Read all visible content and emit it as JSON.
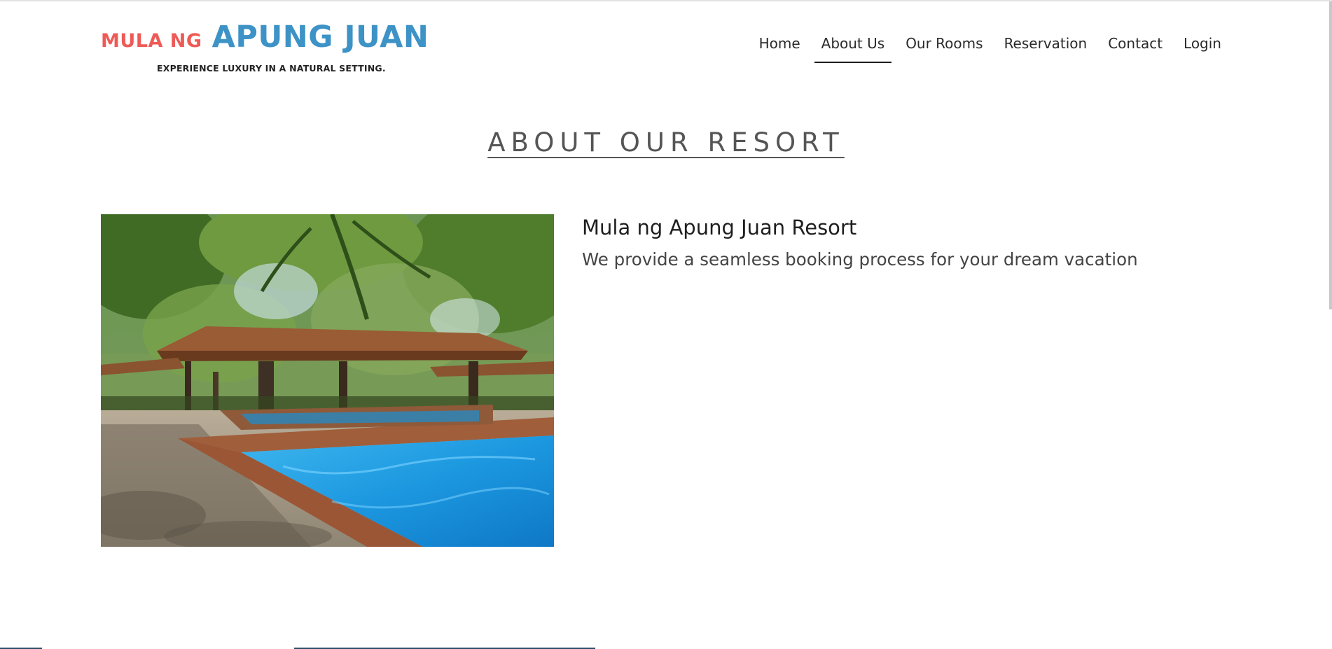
{
  "brand": {
    "prefix": "MULA NG",
    "name": "APUNG JUAN",
    "tagline": "EXPERIENCE LUXURY IN A NATURAL SETTING.",
    "colors": {
      "prefix": "#ee5b57",
      "name": "#3d92c6"
    }
  },
  "nav": {
    "items": [
      {
        "label": "Home"
      },
      {
        "label": "About Us",
        "active": true
      },
      {
        "label": "Our Rooms"
      },
      {
        "label": "Reservation"
      },
      {
        "label": "Contact"
      },
      {
        "label": "Login"
      }
    ]
  },
  "section": {
    "heading": "ABOUT OUR RESORT"
  },
  "about": {
    "title": "Mula ng Apung Juan Resort",
    "description": "We provide a seamless booking process for your dream vacation",
    "image_subject": "resort-pool-photo"
  }
}
